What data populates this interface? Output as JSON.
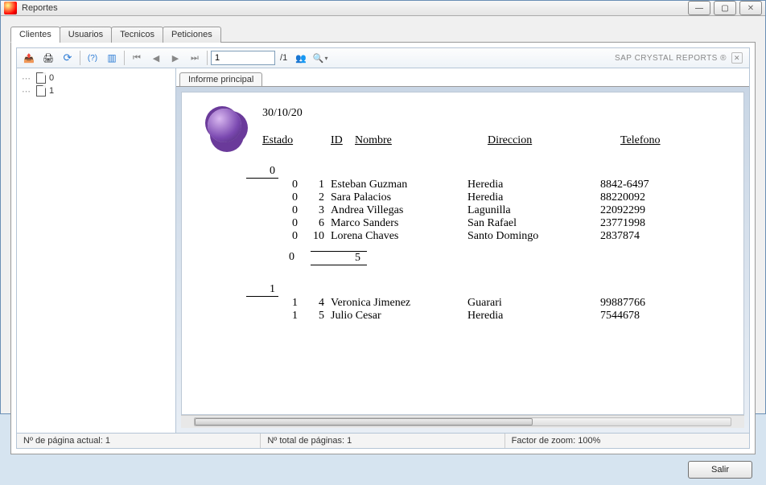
{
  "window": {
    "title": "Reportes"
  },
  "tabs": [
    "Clientes",
    "Usuarios",
    "Tecnicos",
    "Peticiones"
  ],
  "active_tab": 0,
  "toolbar": {
    "page_value": "1",
    "page_total_prefix": "/",
    "page_total": "1",
    "brand": "SAP CRYSTAL REPORTS ®"
  },
  "tree": [
    "0",
    "1"
  ],
  "subtab": "Informe principal",
  "report": {
    "date": "30/10/20",
    "headers": {
      "estado": "Estado",
      "id": "ID",
      "nombre": "Nombre",
      "direccion": "Direccion",
      "telefono": "Telefono"
    },
    "groups": [
      {
        "key": "0",
        "rows": [
          {
            "estado": "0",
            "id": "1",
            "nombre": "Esteban Guzman",
            "direccion": "Heredia",
            "telefono": "8842-6497"
          },
          {
            "estado": "0",
            "id": "2",
            "nombre": "Sara Palacios",
            "direccion": "Heredia",
            "telefono": "88220092"
          },
          {
            "estado": "0",
            "id": "3",
            "nombre": "Andrea Villegas",
            "direccion": "Lagunilla",
            "telefono": "22092299"
          },
          {
            "estado": "0",
            "id": "6",
            "nombre": "Marco Sanders",
            "direccion": "San Rafael",
            "telefono": "23771998"
          },
          {
            "estado": "0",
            "id": "10",
            "nombre": "Lorena Chaves",
            "direccion": "Santo Domingo",
            "telefono": "2837874"
          }
        ],
        "subtotal_label": "0",
        "subtotal_count": "5"
      },
      {
        "key": "1",
        "rows": [
          {
            "estado": "1",
            "id": "4",
            "nombre": "Veronica Jimenez",
            "direccion": "Guarari",
            "telefono": "99887766"
          },
          {
            "estado": "1",
            "id": "5",
            "nombre": "Julio Cesar",
            "direccion": "Heredia",
            "telefono": "7544678"
          }
        ]
      }
    ]
  },
  "status": {
    "page_current_label": "Nº de página actual:",
    "page_current": "1",
    "page_total_label": "Nº total de páginas:",
    "page_total": "1",
    "zoom_label": "Factor de zoom:",
    "zoom": "100%"
  },
  "footer": {
    "exit": "Salir"
  }
}
